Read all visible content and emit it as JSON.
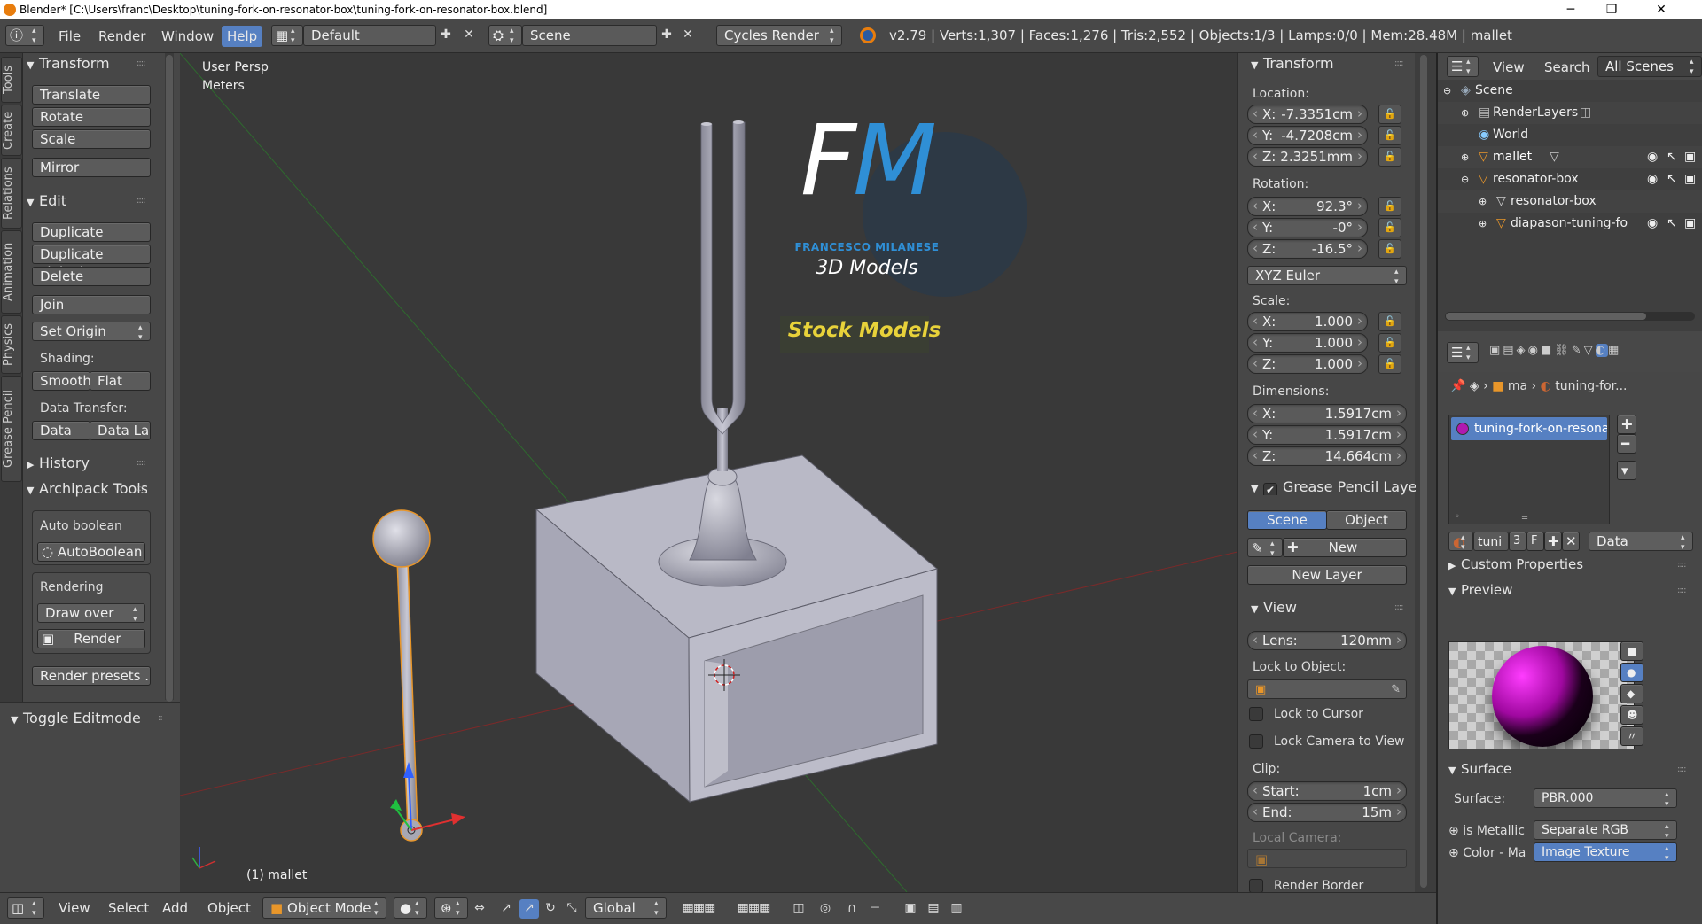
{
  "window": {
    "title": "Blender* [C:\\Users\\franc\\Desktop\\tuning-fork-on-resonator-box\\tuning-fork-on-resonator-box.blend]",
    "controls": [
      "─",
      "❐",
      "✕"
    ]
  },
  "header": {
    "menus": [
      "File",
      "Render",
      "Window",
      "Help"
    ],
    "screen_layout": "Default",
    "scene": "Scene",
    "engine": "Cycles Render",
    "stats": "v2.79 | Verts:1,307 | Faces:1,276 | Tris:2,552 | Objects:1/3 | Lamps:0/0 | Mem:28.48M | mallet"
  },
  "side_tabs": [
    "Tools",
    "Create",
    "Relations",
    "Animation",
    "Physics",
    "Grease Pencil"
  ],
  "tools": {
    "transform_title": "Transform",
    "translate": "Translate",
    "rotate": "Rotate",
    "scale": "Scale",
    "mirror": "Mirror",
    "edit_title": "Edit",
    "duplicate": "Duplicate",
    "duplicate_linked": "Duplicate Linked",
    "delete": "Delete",
    "join": "Join",
    "set_origin": "Set Origin",
    "shading_label": "Shading:",
    "smooth": "Smooth",
    "flat": "Flat",
    "data_transfer_label": "Data Transfer:",
    "data": "Data",
    "data_layout": "Data La",
    "history_title": "History",
    "archipack_title": "Archipack Tools",
    "auto_boolean_label": "Auto boolean",
    "auto_boolean_btn": "AutoBoolean",
    "rendering_label": "Rendering",
    "draw_over": "Draw over",
    "render_btn": "Render",
    "render_presets": "Render presets ...",
    "toggle_editmode": "Toggle Editmode"
  },
  "viewport": {
    "view_name": "User Persp",
    "units": "Meters",
    "active_object": "(1) mallet",
    "logo_letters": "FM",
    "logo_name": "FRANCESCO MILANESE",
    "logo_sub": "3D Models",
    "logo_banner": "Stock Models"
  },
  "npanel": {
    "transform_title": "Transform",
    "location_label": "Location:",
    "location": [
      {
        "k": "X:",
        "v": "-7.3351cm"
      },
      {
        "k": "Y:",
        "v": "-4.7208cm"
      },
      {
        "k": "Z:",
        "v": "2.3251mm"
      }
    ],
    "rotation_label": "Rotation:",
    "rotation": [
      {
        "k": "X:",
        "v": "92.3°"
      },
      {
        "k": "Y:",
        "v": "-0°"
      },
      {
        "k": "Z:",
        "v": "-16.5°"
      }
    ],
    "rotation_mode": "XYZ Euler",
    "scale_label": "Scale:",
    "scale": [
      {
        "k": "X:",
        "v": "1.000"
      },
      {
        "k": "Y:",
        "v": "1.000"
      },
      {
        "k": "Z:",
        "v": "1.000"
      }
    ],
    "dimensions_label": "Dimensions:",
    "dimensions": [
      {
        "k": "X:",
        "v": "1.5917cm"
      },
      {
        "k": "Y:",
        "v": "1.5917cm"
      },
      {
        "k": "Z:",
        "v": "14.664cm"
      }
    ],
    "gp_title": "Grease Pencil Layer",
    "gp_scene": "Scene",
    "gp_object": "Object",
    "gp_new": "New",
    "gp_new_layer": "New Layer",
    "view_title": "View",
    "lens_label": "Lens:",
    "lens_value": "120mm",
    "lock_to_object": "Lock to Object:",
    "lock_to_cursor": "Lock to Cursor",
    "lock_camera": "Lock Camera to View",
    "clip_label": "Clip:",
    "clip_start_k": "Start:",
    "clip_start_v": "1cm",
    "clip_end_k": "End:",
    "clip_end_v": "15m",
    "local_camera": "Local Camera:",
    "render_border": "Render Border"
  },
  "outliner": {
    "view": "View",
    "search": "Search",
    "filter": "All Scenes",
    "items": [
      "Scene",
      "RenderLayers",
      "World",
      "mallet",
      "resonator-box",
      "resonator-box",
      "diapason-tuning-fo"
    ]
  },
  "properties": {
    "crumb_obj": "ma",
    "crumb_mat": "tuning-for...",
    "material_slot": "tuning-fork-on-resonator-...",
    "mat_name": "tuni",
    "users": "3",
    "fake": "F",
    "link": "Data",
    "custom_props": "Custom Properties",
    "preview": "Preview",
    "surface_title": "Surface",
    "surface_label": "Surface:",
    "surface_value": "PBR.000",
    "is_metallic_label": "is Metallic",
    "is_metallic_value": "Separate RGB",
    "color_label": "Color - Ma",
    "color_value": "Image Texture"
  },
  "bottom": {
    "menus": [
      "View",
      "Select",
      "Add",
      "Object"
    ],
    "mode": "Object Mode",
    "orientation": "Global"
  },
  "colors": {
    "accent": "#5680c2",
    "header": "#484848",
    "panel": "#474747",
    "viewport": "#393939",
    "logo_blue": "#2f8fd6",
    "banner_yellow": "#e8d23a"
  }
}
